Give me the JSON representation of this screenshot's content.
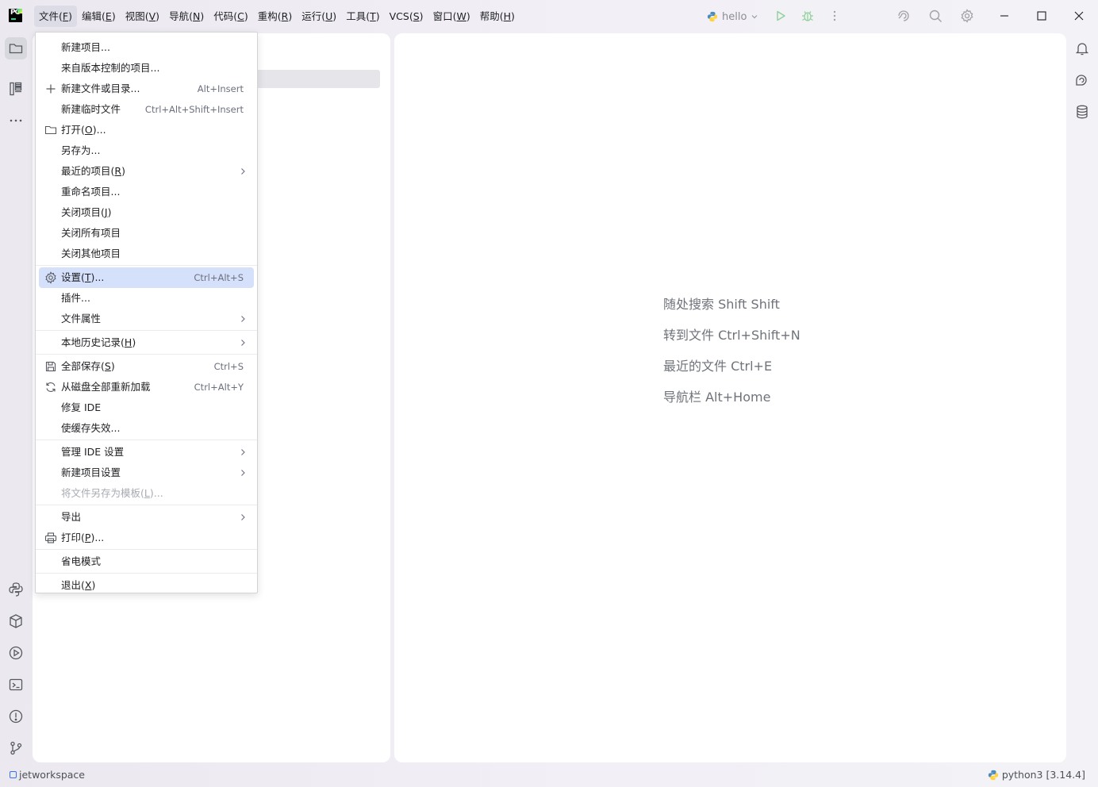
{
  "menubar": {
    "items": [
      {
        "label": "文件",
        "mnemonic": "F"
      },
      {
        "label": "编辑",
        "mnemonic": "E"
      },
      {
        "label": "视图",
        "mnemonic": "V"
      },
      {
        "label": "导航",
        "mnemonic": "N"
      },
      {
        "label": "代码",
        "mnemonic": "C"
      },
      {
        "label": "重构",
        "mnemonic": "R"
      },
      {
        "label": "运行",
        "mnemonic": "U"
      },
      {
        "label": "工具",
        "mnemonic": "T"
      },
      {
        "label": "VCS",
        "mnemonic": "S"
      },
      {
        "label": "窗口",
        "mnemonic": "W"
      },
      {
        "label": "帮助",
        "mnemonic": "H"
      }
    ],
    "active_index": 0
  },
  "toolbar": {
    "run_config": "hello",
    "icons": [
      "python-icon",
      "chevron-down-icon",
      "run-icon",
      "debug-icon",
      "more-vertical-icon",
      "ai-assistant-icon",
      "search-icon",
      "settings-gear-icon"
    ]
  },
  "window_controls": [
    "minimize-icon",
    "maximize-icon",
    "close-icon"
  ],
  "left_strip": {
    "top": [
      "project-folder-icon",
      "structure-icon",
      "more-horizontal-icon"
    ],
    "bottom": [
      "python-console-icon",
      "python-packages-icon",
      "services-icon",
      "terminal-icon",
      "problems-icon",
      "git-icon"
    ]
  },
  "right_strip": [
    "notifications-bell-icon",
    "ai-chat-icon",
    "database-icon"
  ],
  "file_menu": {
    "groups": [
      [
        {
          "label": "新建项目...",
          "icon": ""
        },
        {
          "label": "来自版本控制的项目...",
          "icon": ""
        },
        {
          "label": "新建文件或目录...",
          "shortcut": "Alt+Insert",
          "icon": "plus-icon"
        },
        {
          "label": "新建临时文件",
          "shortcut": "Ctrl+Alt+Shift+Insert",
          "icon": ""
        },
        {
          "label": "打开",
          "mnemonic": "O",
          "suffix": "...",
          "icon": "folder-icon"
        },
        {
          "label": "另存为...",
          "icon": ""
        },
        {
          "label": "最近的项目",
          "mnemonic": "R",
          "submenu": true
        },
        {
          "label": "重命名项目...",
          "icon": ""
        },
        {
          "label": "关闭项目",
          "mnemonic": "J"
        },
        {
          "label": "关闭所有项目"
        },
        {
          "label": "关闭其他项目"
        }
      ],
      [
        {
          "label": "设置",
          "mnemonic": "T",
          "suffix": "...",
          "shortcut": "Ctrl+Alt+S",
          "icon": "settings-gear-icon",
          "selected": true
        },
        {
          "label": "插件..."
        },
        {
          "label": "文件属性",
          "submenu": true
        }
      ],
      [
        {
          "label": "本地历史记录",
          "mnemonic": "H",
          "submenu": true
        }
      ],
      [
        {
          "label": "全部保存",
          "mnemonic": "S",
          "shortcut": "Ctrl+S",
          "icon": "save-icon"
        },
        {
          "label": "从磁盘全部重新加载",
          "shortcut": "Ctrl+Alt+Y",
          "icon": "reload-icon"
        },
        {
          "label": "修复 IDE"
        },
        {
          "label": "使缓存失效..."
        }
      ],
      [
        {
          "label": "管理 IDE 设置",
          "submenu": true
        },
        {
          "label": "新建项目设置",
          "submenu": true
        },
        {
          "label": "将文件另存为模板",
          "mnemonic": "L",
          "suffix": "...",
          "disabled": true
        }
      ],
      [
        {
          "label": "导出",
          "submenu": true
        },
        {
          "label": "打印",
          "mnemonic": "P",
          "suffix": "...",
          "icon": "print-icon"
        }
      ],
      [
        {
          "label": "省电模式"
        }
      ],
      [
        {
          "label": "退出",
          "mnemonic": "X"
        }
      ]
    ]
  },
  "editor_hints": [
    "随处搜索 Shift Shift",
    "转到文件 Ctrl+Shift+N",
    "最近的文件 Ctrl+E",
    "导航栏 Alt+Home"
  ],
  "statusbar": {
    "project": "jetworkspace",
    "interpreter": "python3 [3.14.4]"
  },
  "colors": {
    "accent": "#3574f0",
    "selection": "#d5e1fb",
    "run_green": "#5fb865"
  }
}
